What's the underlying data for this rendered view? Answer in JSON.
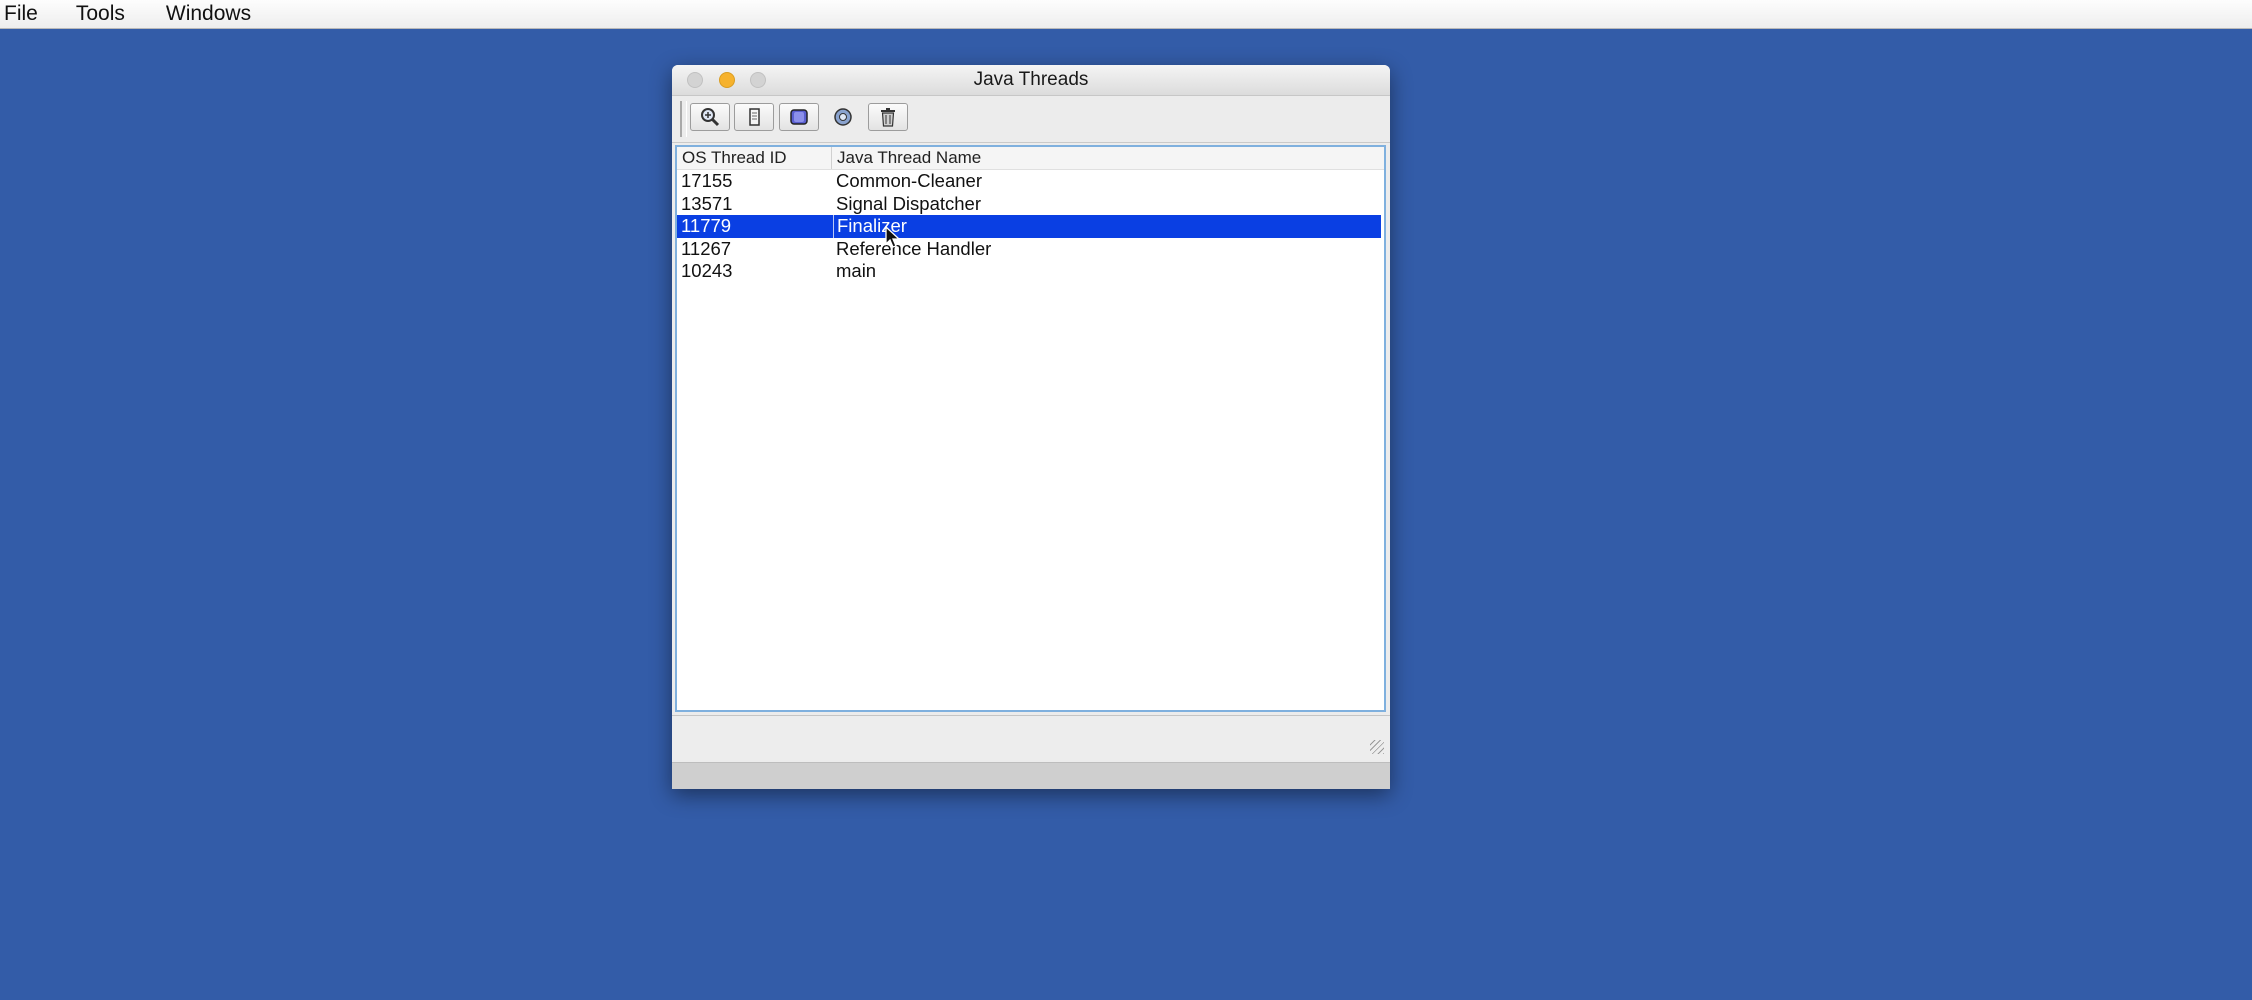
{
  "menubar": {
    "items": [
      {
        "label": "File"
      },
      {
        "label": "Tools"
      },
      {
        "label": "Windows"
      }
    ]
  },
  "window": {
    "title": "Java Threads",
    "toolbar": {
      "buttons": [
        {
          "icon": "inspect-magnifier-icon"
        },
        {
          "icon": "stack-trace-icon"
        },
        {
          "icon": "thread-info-icon"
        },
        {
          "icon": "find-crashes-icon"
        },
        {
          "icon": "trash-icon"
        }
      ]
    },
    "table": {
      "columns": [
        "OS Thread ID",
        "Java Thread Name"
      ],
      "rows": [
        {
          "os_thread_id": "17155",
          "name": "Common-Cleaner",
          "selected": false
        },
        {
          "os_thread_id": "13571",
          "name": "Signal Dispatcher",
          "selected": false
        },
        {
          "os_thread_id": "11779",
          "name": "Finalizer",
          "selected": true
        },
        {
          "os_thread_id": "11267",
          "name": "Reference Handler",
          "selected": false
        },
        {
          "os_thread_id": "10243",
          "name": "main",
          "selected": false
        }
      ]
    }
  },
  "colors": {
    "desktop": "#335ca8",
    "selection": "#0a3fe3",
    "minimize_button": "#f6b22d"
  }
}
